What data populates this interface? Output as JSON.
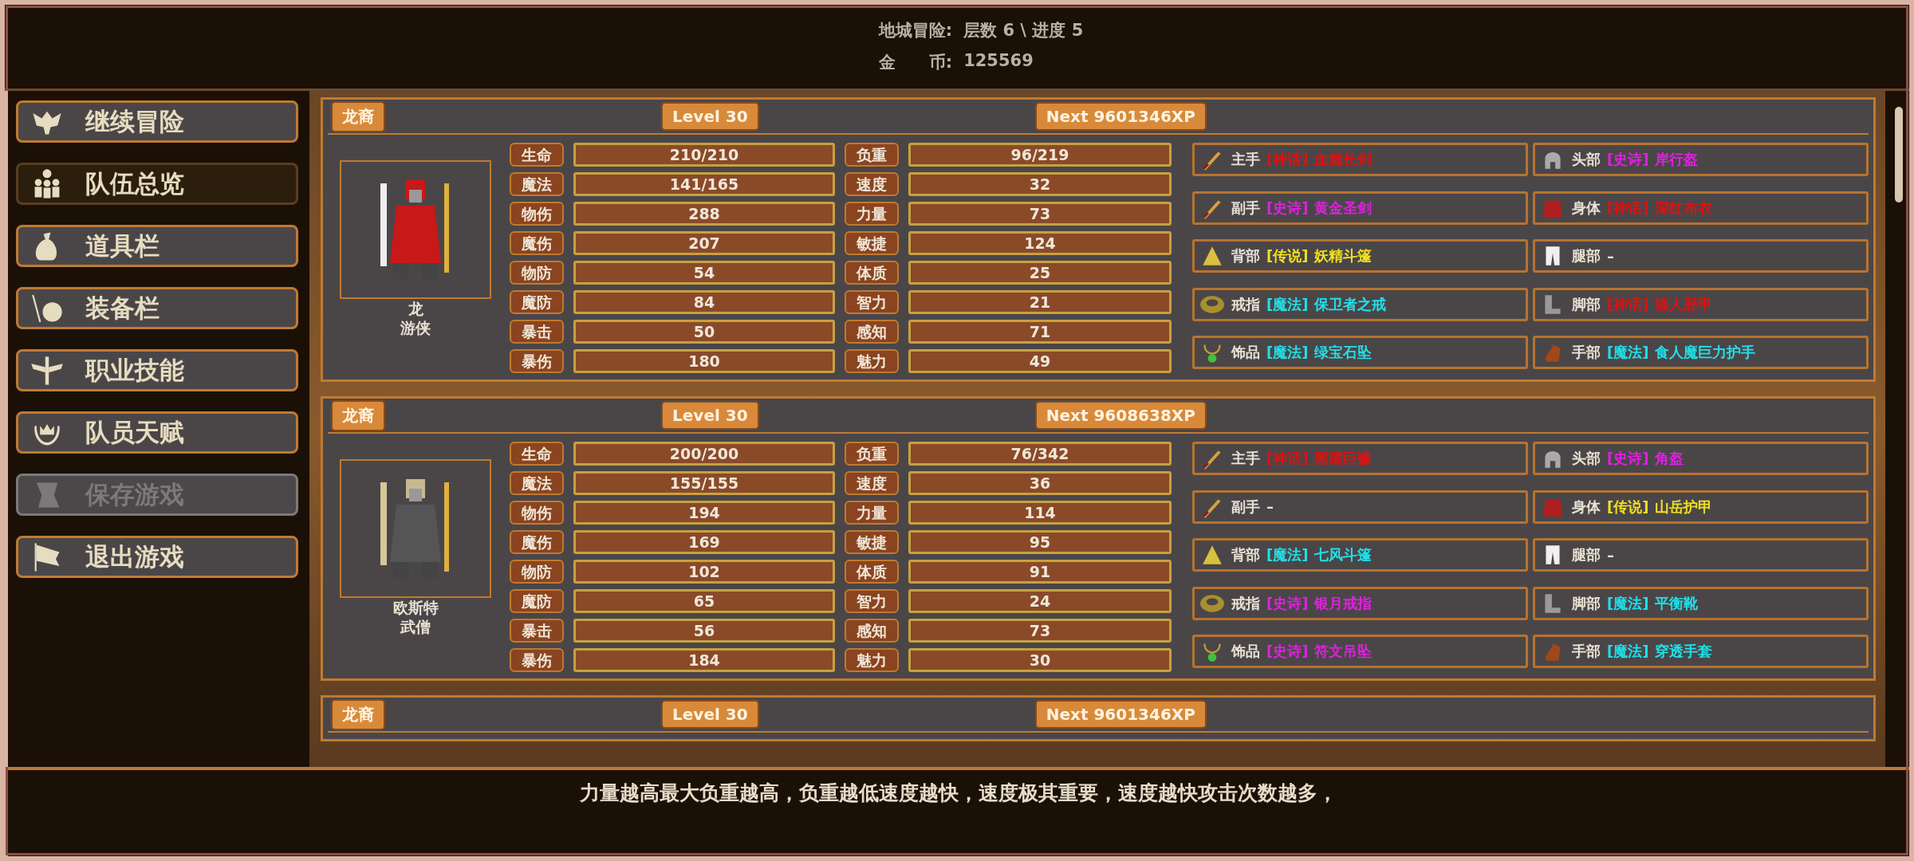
{
  "header": {
    "lines": [
      {
        "label": "地城冒险:",
        "value": "层数 6 \\ 进度 5"
      },
      {
        "label": "金　　币:",
        "value": "125569"
      }
    ]
  },
  "sidebar": {
    "items": [
      {
        "label": "继续冒险",
        "selected": false,
        "disabled": false
      },
      {
        "label": "队伍总览",
        "selected": true,
        "disabled": false
      },
      {
        "label": "道具栏",
        "selected": false,
        "disabled": false
      },
      {
        "label": "装备栏",
        "selected": false,
        "disabled": false
      },
      {
        "label": "职业技能",
        "selected": false,
        "disabled": false
      },
      {
        "label": "队员天赋",
        "selected": false,
        "disabled": false
      },
      {
        "label": "保存游戏",
        "selected": false,
        "disabled": true
      },
      {
        "label": "退出游戏",
        "selected": false,
        "disabled": false
      }
    ]
  },
  "characters": [
    {
      "race": "龙裔",
      "level": "Level 30",
      "next": "Next 9601346XP",
      "name": "龙",
      "class": "游侠",
      "stats": [
        {
          "label": "生命",
          "value": "210/210"
        },
        {
          "label": "负重",
          "value": "96/219"
        },
        {
          "label": "魔法",
          "value": "141/165"
        },
        {
          "label": "速度",
          "value": "32"
        },
        {
          "label": "物伤",
          "value": "288"
        },
        {
          "label": "力量",
          "value": "73"
        },
        {
          "label": "魔伤",
          "value": "207"
        },
        {
          "label": "敏捷",
          "value": "124"
        },
        {
          "label": "物防",
          "value": "54"
        },
        {
          "label": "体质",
          "value": "25"
        },
        {
          "label": "魔防",
          "value": "84"
        },
        {
          "label": "智力",
          "value": "21"
        },
        {
          "label": "暴击",
          "value": "50"
        },
        {
          "label": "感知",
          "value": "71"
        },
        {
          "label": "暴伤",
          "value": "180"
        },
        {
          "label": "魅力",
          "value": "49"
        }
      ],
      "equipment": [
        {
          "slot": "主手",
          "rarity": "[神话]",
          "name": "血瘾长剑",
          "color": "#e01010"
        },
        {
          "slot": "头部",
          "rarity": "[史诗]",
          "name": "岸行盔",
          "color": "#e020e0"
        },
        {
          "slot": "副手",
          "rarity": "[史诗]",
          "name": "黄金圣剑",
          "color": "#e020e0"
        },
        {
          "slot": "身体",
          "rarity": "[神话]",
          "name": "深红布衣",
          "color": "#e01010"
        },
        {
          "slot": "背部",
          "rarity": "[传说]",
          "name": "妖精斗篷",
          "color": "#f0e020"
        },
        {
          "slot": "腿部",
          "name": "–"
        },
        {
          "slot": "戒指",
          "rarity": "[魔法]",
          "name": "保卫者之戒",
          "color": "#20e0e8"
        },
        {
          "slot": "脚部",
          "rarity": "[神话]",
          "name": "矮人胫甲",
          "color": "#e01010"
        },
        {
          "slot": "饰品",
          "rarity": "[魔法]",
          "name": "绿宝石坠",
          "color": "#20e0e8"
        },
        {
          "slot": "手部",
          "rarity": "[魔法]",
          "name": "食人魔巨力护手",
          "color": "#20e0e8"
        }
      ]
    },
    {
      "race": "龙裔",
      "level": "Level 30",
      "next": "Next 9608638XP",
      "name": "欧斯特",
      "class": "武僧",
      "stats": [
        {
          "label": "生命",
          "value": "200/200"
        },
        {
          "label": "负重",
          "value": "76/342"
        },
        {
          "label": "魔法",
          "value": "155/155"
        },
        {
          "label": "速度",
          "value": "36"
        },
        {
          "label": "物伤",
          "value": "194"
        },
        {
          "label": "力量",
          "value": "114"
        },
        {
          "label": "魔伤",
          "value": "169"
        },
        {
          "label": "敏捷",
          "value": "95"
        },
        {
          "label": "物防",
          "value": "102"
        },
        {
          "label": "体质",
          "value": "91"
        },
        {
          "label": "魔防",
          "value": "65"
        },
        {
          "label": "智力",
          "value": "24"
        },
        {
          "label": "暴击",
          "value": "56"
        },
        {
          "label": "感知",
          "value": "73"
        },
        {
          "label": "暴伤",
          "value": "184"
        },
        {
          "label": "魅力",
          "value": "30"
        }
      ],
      "equipment": [
        {
          "slot": "主手",
          "rarity": "[神话]",
          "name": "黑曜巨镰",
          "color": "#e01010"
        },
        {
          "slot": "头部",
          "rarity": "[史诗]",
          "name": "角盔",
          "color": "#e020e0"
        },
        {
          "slot": "副手",
          "name": "–"
        },
        {
          "slot": "身体",
          "rarity": "[传说]",
          "name": "山岳护甲",
          "color": "#f0e020"
        },
        {
          "slot": "背部",
          "rarity": "[魔法]",
          "name": "七风斗篷",
          "color": "#20e0e8"
        },
        {
          "slot": "腿部",
          "name": "–"
        },
        {
          "slot": "戒指",
          "rarity": "[史诗]",
          "name": "银月戒指",
          "color": "#e020e0"
        },
        {
          "slot": "脚部",
          "rarity": "[魔法]",
          "name": "平衡靴",
          "color": "#20e0e8"
        },
        {
          "slot": "饰品",
          "rarity": "[史诗]",
          "name": "符文吊坠",
          "color": "#e020e0"
        },
        {
          "slot": "手部",
          "rarity": "[魔法]",
          "name": "穿透手套",
          "color": "#20e0e8"
        }
      ]
    },
    {
      "race": "龙裔",
      "level": "Level 30",
      "next": "Next 9601346XP"
    }
  ],
  "footer": {
    "tip": "力量越高最大负重越高，负重越低速度越快，速度极其重要，速度越快攻击次数越多，"
  }
}
